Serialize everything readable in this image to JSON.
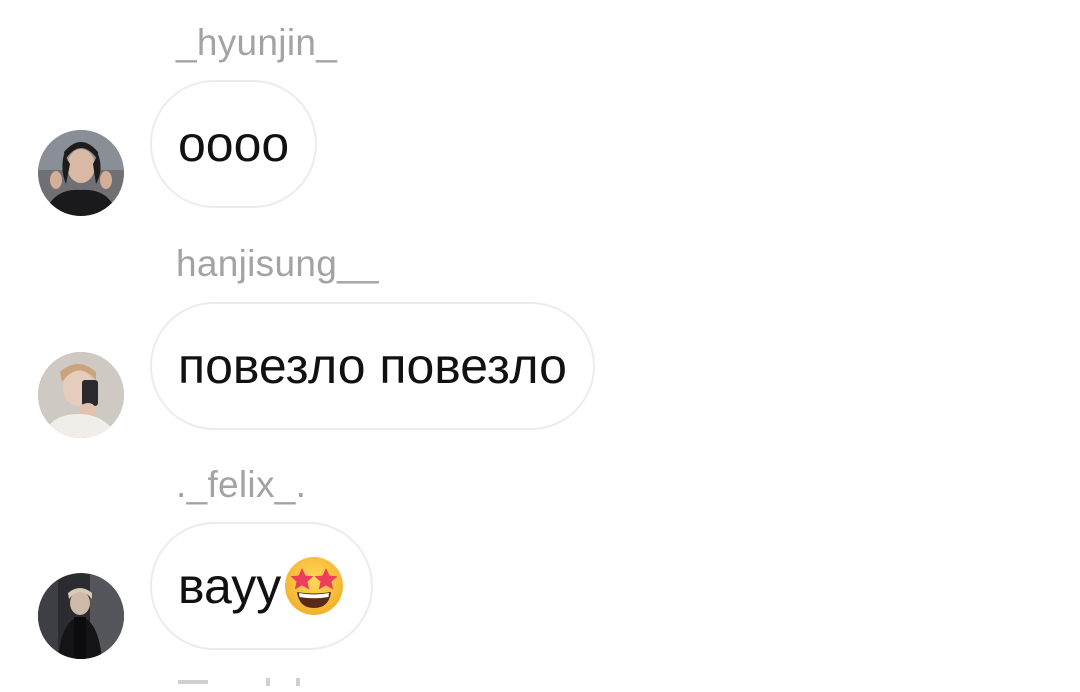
{
  "messages": [
    {
      "username": "_hyunjin_",
      "text": "oooo",
      "avatar": "hyunjin-avatar"
    },
    {
      "username": "hanjisung__",
      "text": "повезло повезло",
      "avatar": "hanjisung-avatar"
    },
    {
      "username": "._felix_.",
      "text": "вауу",
      "emoji": "star-struck-emoji",
      "avatar": "felix-avatar"
    }
  ],
  "colors": {
    "username": "#a3a3a3",
    "bubble_border": "#ececec",
    "text": "#111111",
    "emoji_face": "#f7c23a",
    "emoji_star": "#ee3e5c"
  }
}
